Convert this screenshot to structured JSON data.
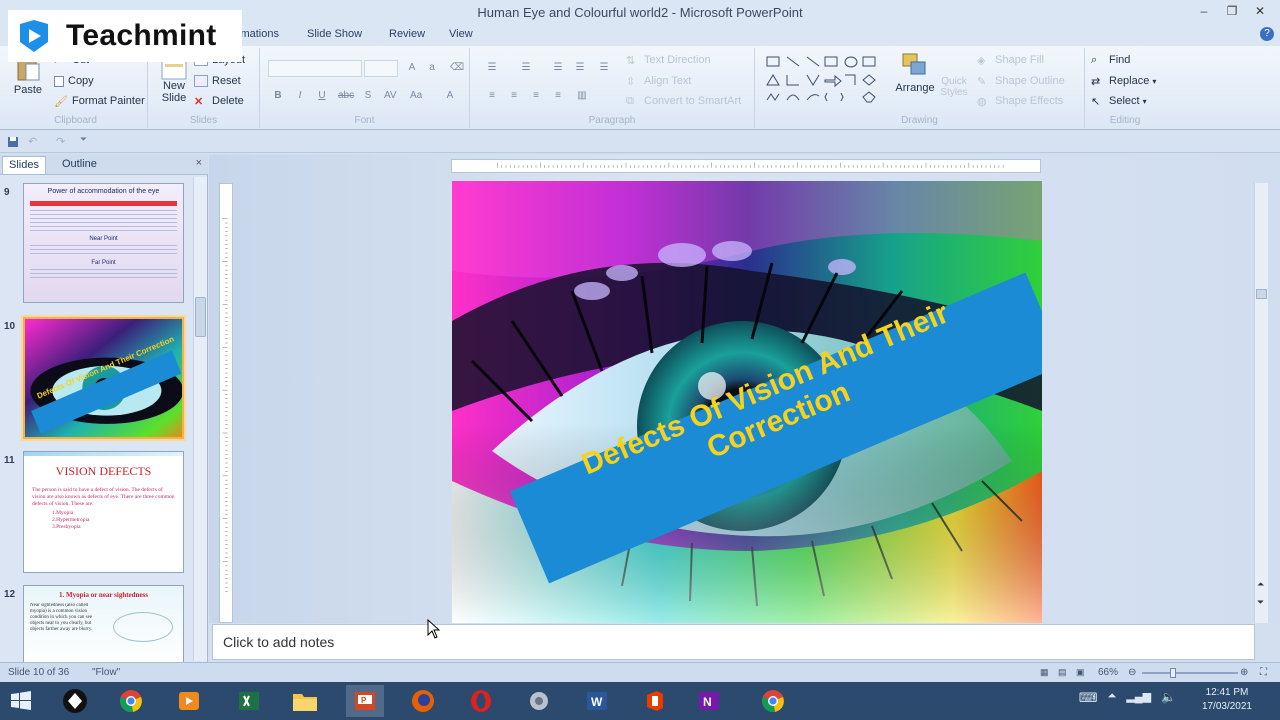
{
  "window": {
    "title": "Human Eye and Colourful world2 - Microsoft PowerPoint",
    "minimize": "–",
    "maximize": "❐",
    "close": "✕"
  },
  "watermark": {
    "text": "Teachmint"
  },
  "tabs": [
    {
      "label": "imations"
    },
    {
      "label": "Slide Show"
    },
    {
      "label": "Review"
    },
    {
      "label": "View"
    }
  ],
  "ribbon": {
    "clipboard": {
      "title": "Clipboard",
      "paste": "Paste",
      "cut": "Cut",
      "copy": "Copy",
      "format_painter": "Format Painter"
    },
    "slides": {
      "title": "Slides",
      "new_slide": "New Slide",
      "layout": "Layout",
      "reset": "Reset",
      "delete": "Delete"
    },
    "font": {
      "title": "Font"
    },
    "paragraph": {
      "title": "Paragraph",
      "text_direction": "Text Direction",
      "align_text": "Align Text",
      "convert_smartart": "Convert to SmartArt"
    },
    "drawing": {
      "title": "Drawing",
      "arrange": "Arrange",
      "quick_styles": "Quick Styles",
      "shape_fill": "Shape Fill",
      "shape_outline": "Shape Outline",
      "shape_effects": "Shape Effects"
    },
    "editing": {
      "title": "Editing",
      "find": "Find",
      "replace": "Replace",
      "select": "Select"
    }
  },
  "left_pane": {
    "tab_slides": "Slides",
    "tab_outline": "Outline",
    "close": "×",
    "thumbnails": [
      {
        "number": "9",
        "title": "Power of accommodation of the eye",
        "heading2": "Near Point",
        "heading3": "Far Point"
      },
      {
        "number": "10",
        "banner": "Defects Of Vision And Their Correction"
      },
      {
        "number": "11",
        "title": "VISION DEFECTS",
        "body": "The person is said to have a defect of vision. The defects of vision are also known as defects of eye. There are three common defects of vision. These are:",
        "items": [
          "1.Myopia",
          "2.Hypermetropia",
          "3.Presbyopia"
        ]
      },
      {
        "number": "12",
        "title": "1. Myopia or near sightedness",
        "body": "Near sightedness (also called myopia) is a common vision condition in which you can see objects near to you clearly, but objects farther away are blurry."
      }
    ]
  },
  "slide": {
    "banner_line1": "Defects Of Vision And Their",
    "banner_line2": "Correction"
  },
  "notes": {
    "placeholder": "Click to add notes"
  },
  "status": {
    "slide_counter": "Slide 10 of 36",
    "theme": "\"Flow\"",
    "zoom": "66%"
  },
  "taskbar": {
    "time": "12:41 PM",
    "date": "17/03/2021"
  },
  "colors": {
    "ribbon_bg": "#dce7f5",
    "banner_bg": "#1a8bd4",
    "banner_text": "#f6d31a",
    "selection": "#f2b250",
    "taskbar": "#2b4a6e"
  }
}
